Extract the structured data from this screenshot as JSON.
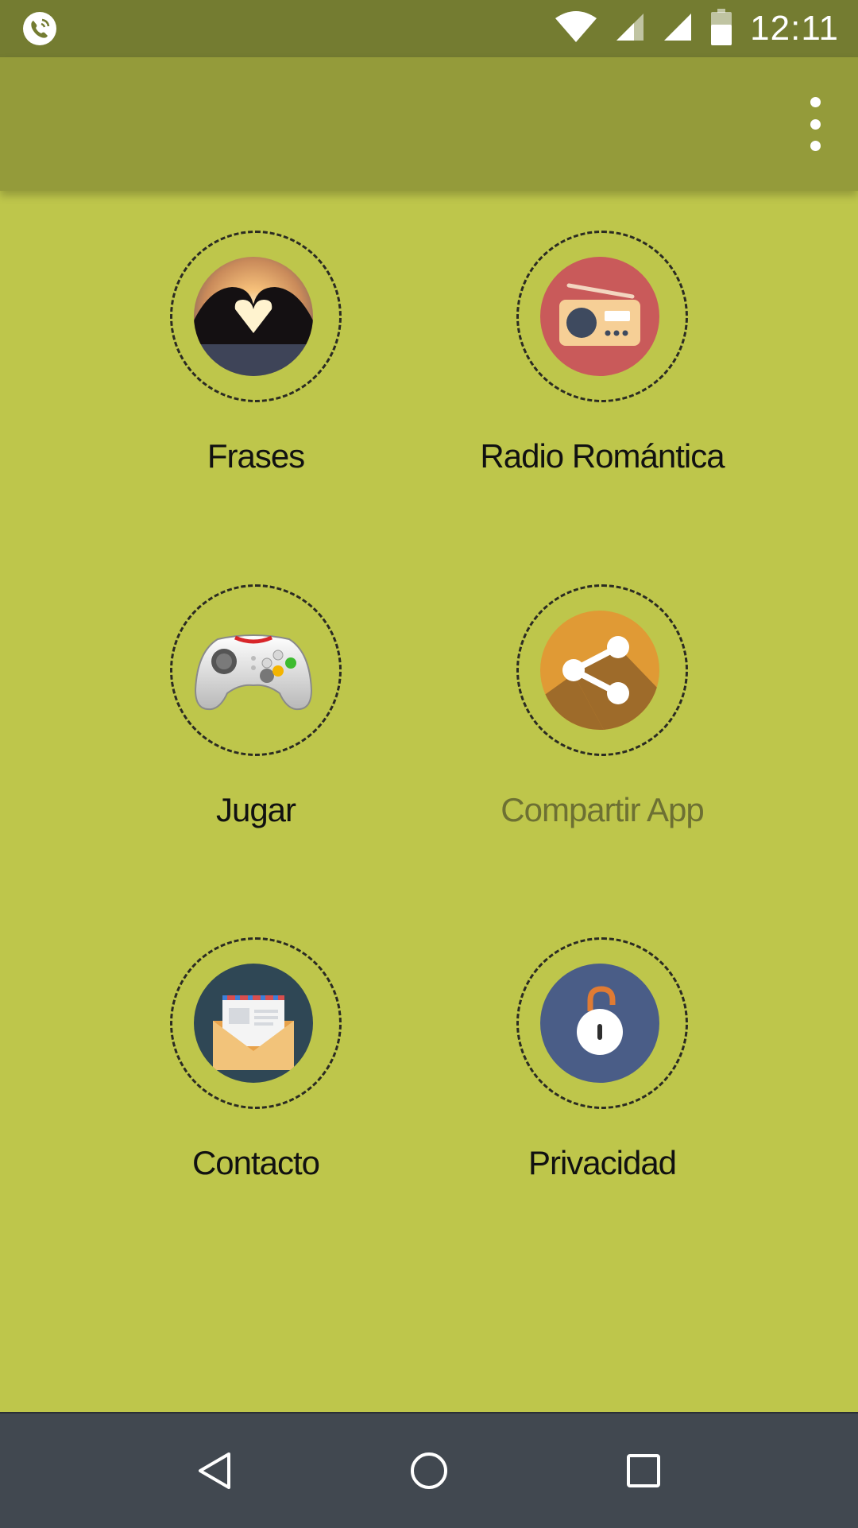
{
  "status_bar": {
    "time": "12:11",
    "left_icon": "phone-call-icon",
    "icons": [
      "wifi-icon",
      "signal-icon",
      "signal-icon",
      "battery-icon"
    ]
  },
  "app_bar": {
    "overflow_icon": "more-vert-icon"
  },
  "menu": {
    "items": [
      {
        "label": "Frases",
        "icon": "heart-hands-icon"
      },
      {
        "label": "Radio Romántica",
        "icon": "radio-icon"
      },
      {
        "label": "Jugar",
        "icon": "gamepad-icon"
      },
      {
        "label": "Compartir App",
        "icon": "share-icon"
      },
      {
        "label": "Contacto",
        "icon": "envelope-icon"
      },
      {
        "label": "Privacidad",
        "icon": "unlocked-padlock-icon"
      }
    ]
  },
  "nav_bar": {
    "buttons": [
      "back-icon",
      "home-icon",
      "recents-icon"
    ]
  },
  "colors": {
    "background": "#bec64b",
    "status_bar": "#747c31",
    "app_bar": "#949b3a",
    "nav_bar": "#414850",
    "radio_disc": "#c95a5a",
    "share_disc": "#e09a35",
    "contact_disc": "#2f4755",
    "privacy_disc": "#4a5d87"
  }
}
